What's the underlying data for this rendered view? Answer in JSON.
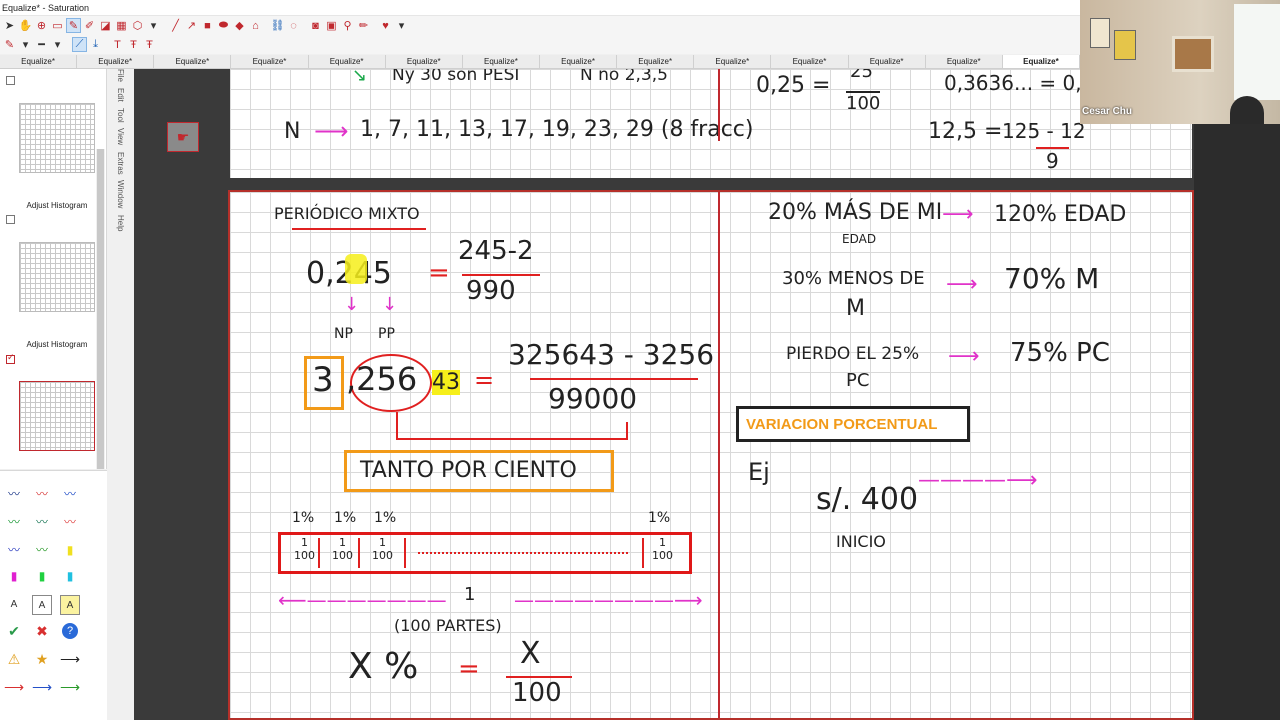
{
  "window": {
    "title": "Equalize* - Saturation"
  },
  "tabs": [
    "Equalize*",
    "Equalize*",
    "Equalize*",
    "Equalize*",
    "Equalize*",
    "Equalize*",
    "Equalize*",
    "Equalize*",
    "Equalize*",
    "Equalize*",
    "Equalize*",
    "Equalize*",
    "Equalize*",
    "Equalize*"
  ],
  "thumbnails": [
    {
      "caption": "Adjust Histogram"
    },
    {
      "caption": "Adjust Histogram"
    },
    {
      "caption": ""
    }
  ],
  "side_menu": [
    "File",
    "Edit",
    "Tool",
    "View",
    "Extras",
    "Window",
    "Help"
  ],
  "webcam": {
    "name": "Cesar Chu"
  },
  "page1": {
    "line1": "Ny 30 son PESI",
    "line1b": "N no 2,3,5",
    "primes_label": "N",
    "primes": "1, 7, 11, 13, 17, 19, 23, 29 (8 fracc)",
    "frac1_left": "0,25 =",
    "frac1_num": "25",
    "frac1_den": "100",
    "dec1": "0,3636... = 0,",
    "dec2": "12,5 =",
    "dec2_num": "125 - 12",
    "dec2_den": "9"
  },
  "page2": {
    "title": "PERIÓDICO MIXTO",
    "ex1_lhs": "0,245",
    "ex1_eq": "=",
    "ex1_num": "245-2",
    "ex1_den": "990",
    "np": "NP",
    "pp": "PP",
    "ex2_int": "3",
    "ex2_dec": ",256",
    "ex2_hl": "43",
    "ex2_eq": "=",
    "ex2_num": "325643 - 3256",
    "ex2_den": "99000",
    "tanto": "TANTO POR CIENTO",
    "pct": "1%",
    "frac_num": "1",
    "frac_den": "100",
    "one": "1",
    "parts": "(100 PARTES)",
    "xpct": "X %",
    "xeq": "=",
    "xnum": "X",
    "xden": "100",
    "r1_a": "20% MÁS DE MI",
    "r1_b": "EDAD",
    "r1_res": "120% EDAD",
    "r2_a": "30% MENOS DE",
    "r2_b": "M",
    "r2_res": "70% M",
    "r3_a": "PIERDO EL 25%",
    "r3_b": "PC",
    "r3_res": "75% PC",
    "variacion": "VARIACION PORCENTUAL",
    "ej": "Ej",
    "s400": "s/. 400",
    "inicio": "INICIO"
  },
  "colors": {
    "accent_red": "#c0282e",
    "pink": "#e033c9",
    "orange": "#f29a18",
    "highlight": "#f6ef1a"
  }
}
